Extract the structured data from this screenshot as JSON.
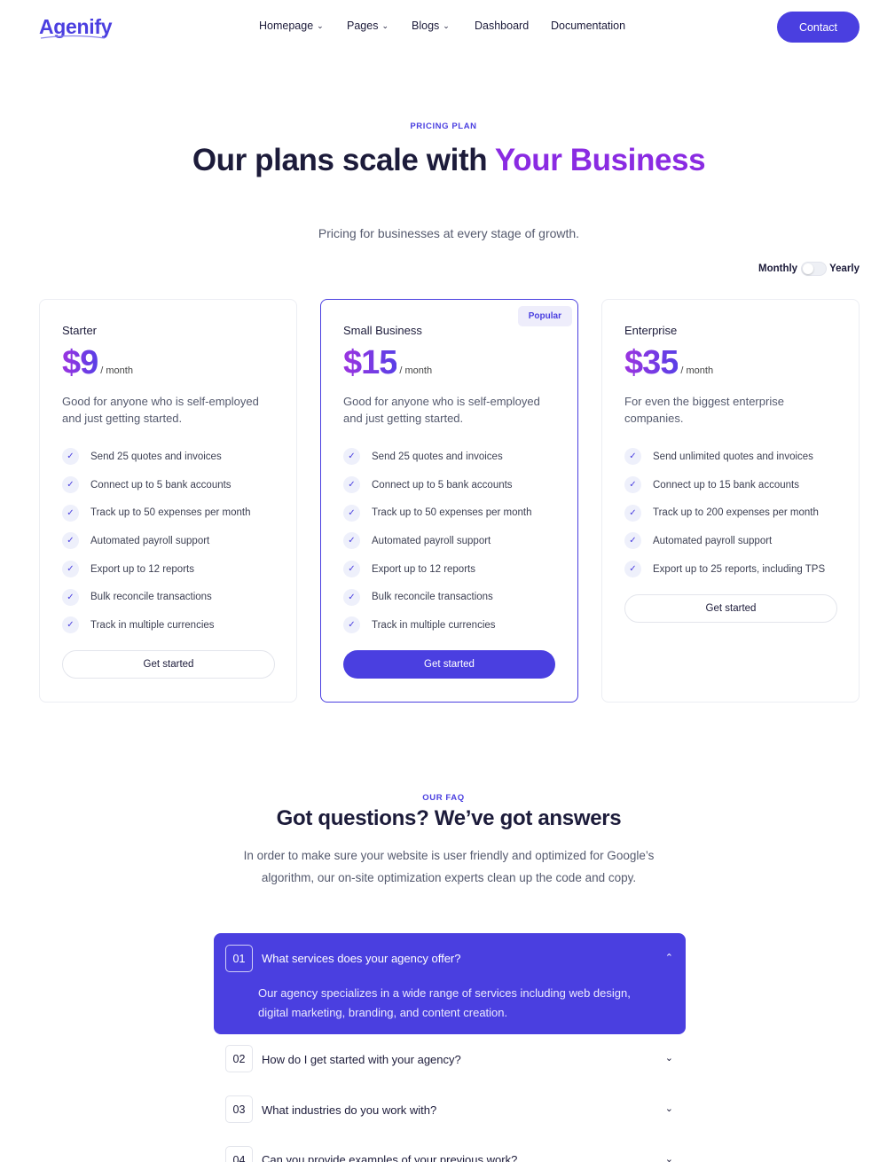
{
  "brand": {
    "logo": "Agenify"
  },
  "nav": {
    "items": [
      {
        "label": "Homepage",
        "dropdown": true
      },
      {
        "label": "Pages",
        "dropdown": true
      },
      {
        "label": "Blogs",
        "dropdown": true
      },
      {
        "label": "Dashboard",
        "dropdown": false
      },
      {
        "label": "Documentation",
        "dropdown": false
      }
    ],
    "contact_label": "Contact"
  },
  "pricing": {
    "eyebrow": "PRICING PLAN",
    "title_part1": "Our plans scale with ",
    "title_accent": "Your Business",
    "subtitle": "Pricing for businesses at every stage of growth.",
    "billing_toggle": {
      "left": "Monthly",
      "right": "Yearly",
      "selected": "Monthly"
    },
    "plans": [
      {
        "name": "Starter",
        "price": "$9",
        "period": "/ month",
        "description": "Good for anyone who is self-employed and just getting started.",
        "features": [
          "Send 25 quotes and invoices",
          "Connect up to 5 bank accounts",
          "Track up to 50 expenses per month",
          "Automated payroll support",
          "Export up to 12 reports",
          "Bulk reconcile transactions",
          "Track in multiple currencies"
        ],
        "cta": "Get started"
      },
      {
        "name": "Small Business",
        "badge": "Popular",
        "price": "$15",
        "period": "/ month",
        "description": "Good for anyone who is self-employed and just getting started.",
        "features": [
          "Send 25 quotes and invoices",
          "Connect up to 5 bank accounts",
          "Track up to 50 expenses per month",
          "Automated payroll support",
          "Export up to 12 reports",
          "Bulk reconcile transactions",
          "Track in multiple currencies"
        ],
        "cta": "Get started"
      },
      {
        "name": "Enterprise",
        "price": "$35",
        "period": "/ month",
        "description": "For even the biggest enterprise companies.",
        "features": [
          "Send unlimited quotes and invoices",
          "Connect up to 15 bank accounts",
          "Track up to 200 expenses per month",
          "Automated payroll support",
          "Export up to 25 reports, including TPS"
        ],
        "cta": "Get started"
      }
    ]
  },
  "faq": {
    "eyebrow": "OUR FAQ",
    "title": "Got questions? We’ve got answers",
    "subtitle": "In order to make sure your website is user friendly and optimized for Google’s algorithm, our on-site optimization experts clean up the code and copy.",
    "items": [
      {
        "num": "01",
        "question": "What services does your agency offer?",
        "answer": "Our agency specializes in a wide range of services including web design, digital marketing, branding, and content creation.",
        "open": true
      },
      {
        "num": "02",
        "question": "How do I get started with your agency?",
        "open": false
      },
      {
        "num": "03",
        "question": "What industries do you work with?",
        "open": false
      },
      {
        "num": "04",
        "question": "Can you provide examples of your previous work?",
        "open": false
      }
    ]
  },
  "colors": {
    "primary": "#4a3fe0",
    "accent": "#8a2be2",
    "text": "#1c1b3a",
    "muted": "#555a6e"
  },
  "icons": {
    "check": "check-icon",
    "chevron_down": "chevron-down-icon",
    "chevron_up": "chevron-up-icon"
  }
}
